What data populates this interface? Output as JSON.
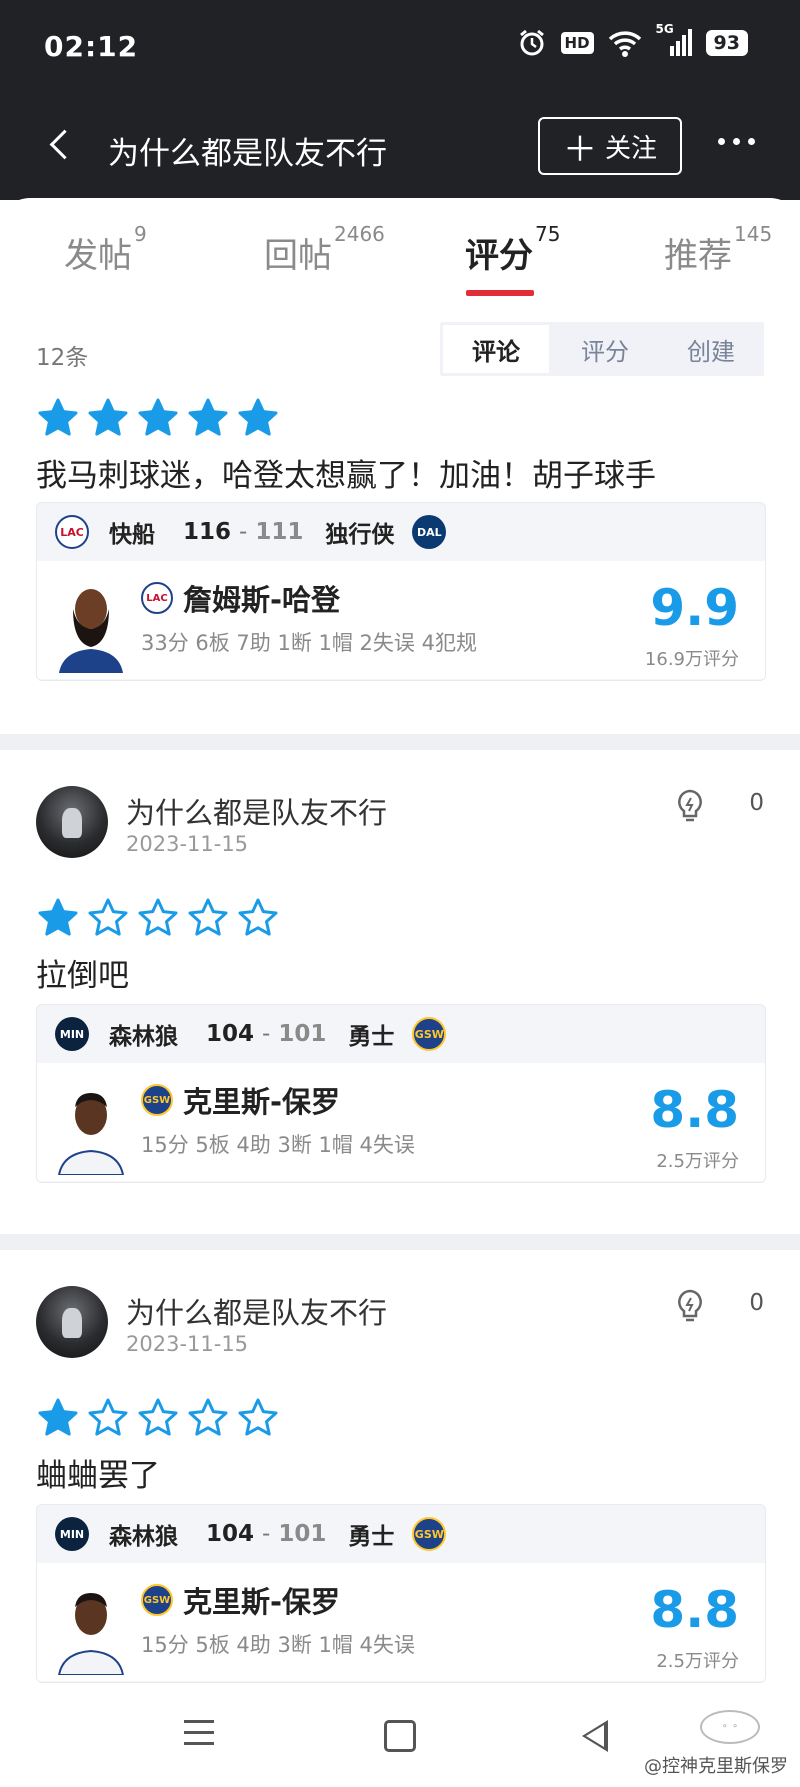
{
  "status_bar": {
    "time": "02:12",
    "hd": "HD",
    "network": "5G",
    "battery": "93"
  },
  "nav": {
    "title": "为什么都是队友不行",
    "follow_label": "关注"
  },
  "tabs": [
    {
      "label": "发帖",
      "count": "9"
    },
    {
      "label": "回帖",
      "count": "2466"
    },
    {
      "label": "评分",
      "count": "75",
      "active": true
    },
    {
      "label": "推荐",
      "count": "145"
    }
  ],
  "list": {
    "count_label": "12条",
    "segments": [
      "评论",
      "评分",
      "创建"
    ],
    "active_segment": "评论"
  },
  "items": [
    {
      "stars": 5,
      "text": "我马刺球迷，哈登太想赢了！加油！胡子球手",
      "game": {
        "home_team": "快船",
        "home_logo": "LAC",
        "home_score": "116",
        "away_score": "111",
        "away_team": "独行侠",
        "away_logo": "DAL"
      },
      "player": {
        "name": "詹姆斯-哈登",
        "team_logo": "LAC",
        "stats": "33分 6板 7助 1断 1帽 2失误 4犯规",
        "rating": "9.9",
        "rating_count": "16.9万评分"
      }
    },
    {
      "user": {
        "name": "为什么都是队友不行",
        "date": "2023-11-15",
        "likes": "0"
      },
      "stars": 1,
      "text": "拉倒吧",
      "game": {
        "home_team": "森林狼",
        "home_logo": "MIN",
        "home_score": "104",
        "away_score": "101",
        "away_team": "勇士",
        "away_logo": "GSW"
      },
      "player": {
        "name": "克里斯-保罗",
        "team_logo": "GSW",
        "stats": "15分 5板 4助 3断 1帽 4失误",
        "rating": "8.8",
        "rating_count": "2.5万评分"
      }
    },
    {
      "user": {
        "name": "为什么都是队友不行",
        "date": "2023-11-15",
        "likes": "0"
      },
      "stars": 1,
      "text": "蛐蛐罢了",
      "game": {
        "home_team": "森林狼",
        "home_logo": "MIN",
        "home_score": "104",
        "away_score": "101",
        "away_team": "勇士",
        "away_logo": "GSW"
      },
      "player": {
        "name": "克里斯-保罗",
        "team_logo": "GSW",
        "stats": "15分 5板 4助 3断 1帽 4失误",
        "rating": "8.8",
        "rating_count": "2.5万评分"
      }
    }
  ],
  "watermark": "@控神克里斯保罗",
  "colors": {
    "accent_red": "#e02d38",
    "rating_blue": "#1a9be8",
    "star_blue": "#1a9be8",
    "dark_bar": "#212226"
  }
}
